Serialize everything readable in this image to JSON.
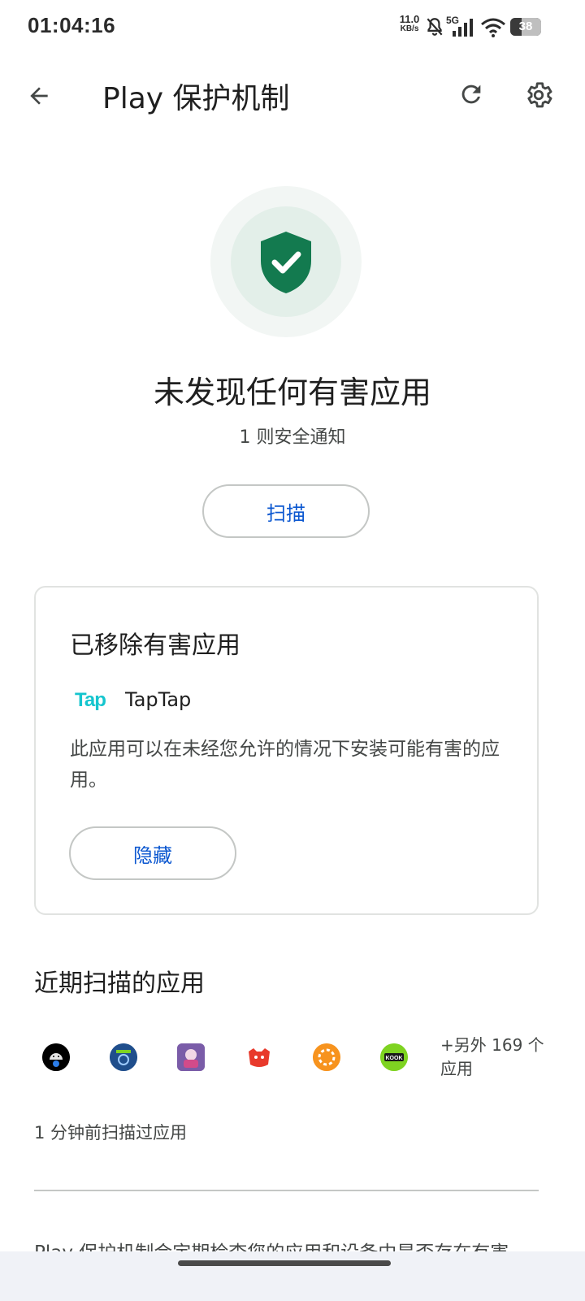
{
  "status_bar": {
    "time": "01:04:16",
    "net_speed_value": "11.0",
    "net_speed_unit": "KB/s",
    "network": "5G",
    "battery": "38",
    "battery_level": 0.38,
    "icons": [
      "mute-bell-icon",
      "signal-icon",
      "wifi-icon",
      "battery-icon"
    ]
  },
  "app_bar": {
    "title": "Play 保护机制",
    "icons": [
      "back-arrow-icon",
      "refresh-icon",
      "gear-icon"
    ]
  },
  "hero": {
    "icon": "shield-check-icon",
    "title": "未发现任何有害应用",
    "subtitle": "1 则安全通知",
    "scan_label": "扫描"
  },
  "removed_card": {
    "title": "已移除有害应用",
    "app_logo_text": "Tap",
    "app_name": "TapTap",
    "description": "此应用可以在未经您允许的情况下安装可能有害的应用。",
    "hide_label": "隐藏"
  },
  "recent": {
    "title": "近期扫描的应用",
    "apps": [
      {
        "name": "android-settings-app-icon",
        "bg": "#000000"
      },
      {
        "name": "blue-app-icon",
        "bg": "#1f4e8c"
      },
      {
        "name": "anime-game-app-icon",
        "bg": "#7a5ca8"
      },
      {
        "name": "red-app-icon",
        "bg": "#ffffff"
      },
      {
        "name": "orange-app-icon",
        "bg": "#f7931e"
      },
      {
        "name": "kook-app-icon",
        "bg": "#7ed321",
        "label": "KOOK"
      }
    ],
    "more_label": "+另外 169 个应用",
    "last_scan": "1 分钟前扫描过应用"
  },
  "footer": {
    "text": "Play 保护机制会定期检查您的应用和设备中是否存在有害"
  },
  "colors": {
    "accent": "#0b57d0",
    "shield": "#137a4f",
    "tap_brand": "#15c5ce"
  }
}
